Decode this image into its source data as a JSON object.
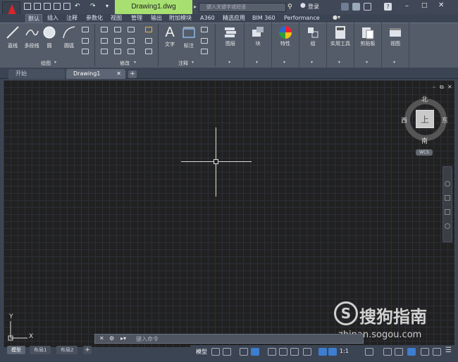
{
  "titlebar": {
    "doc_title": "Drawing1.dwg",
    "search_placeholder": "键入关键字或短语",
    "login": "登录"
  },
  "ribbon_tabs": [
    "默认",
    "插入",
    "注释",
    "参数化",
    "视图",
    "管理",
    "输出",
    "附加模块",
    "A360",
    "精选应用",
    "BIM 360",
    "Performance"
  ],
  "ribbon": {
    "draw_buttons": [
      "直线",
      "多段线",
      "圆",
      "圆弧"
    ],
    "draw_panel": "绘图",
    "modify_panel": "修改",
    "annot_buttons": [
      "文字",
      "标注"
    ],
    "annot_panel": "注释",
    "groups": [
      "图层",
      "块",
      "特性",
      "组",
      "实用工具",
      "剪贴板",
      "视图"
    ]
  },
  "doc_tabs": {
    "start": "开始",
    "drawing": "Drawing1"
  },
  "viewcube": {
    "north": "北",
    "south": "南",
    "east": "东",
    "west": "西",
    "top": "上",
    "wcs": "WCS"
  },
  "ucs": {
    "y": "Y",
    "x": "X"
  },
  "command": {
    "placeholder": "键入命令"
  },
  "layout_tabs": [
    "模型",
    "布局1",
    "布局2"
  ],
  "status": {
    "model": "模型",
    "scale": "1:1"
  },
  "watermark": {
    "text": "搜狗指南",
    "url": "zhinan.sogou.com",
    "logo": "S"
  },
  "colors": {
    "accent": "#a7e070",
    "canvas": "#212121",
    "app_red": "#d9252b"
  }
}
